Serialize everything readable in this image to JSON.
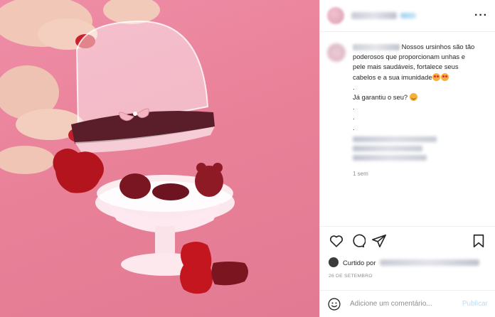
{
  "post": {
    "image_alt": "",
    "caption": {
      "line1": "Nossos ursinhos são tão",
      "line2": "poderosos que proporcionam unhas e",
      "line3": "pele mais saudáveis, fortalece seus",
      "line4": "cabelos e a sua imunidade",
      "dot1": ".",
      "question": "Já garantiu o seu?",
      "dot2": ".",
      "dot3": ".",
      "dot4": "."
    },
    "time_ago": "1 sem",
    "liked_by_prefix": "Curtido por",
    "date": "26 DE SETEMBRO",
    "comment_placeholder": "Adicione um comentário...",
    "publish_label": "Publicar",
    "more_label": "···"
  },
  "icons": {
    "like": "heart-icon",
    "comment": "comment-icon",
    "share": "share-icon",
    "save": "bookmark-icon",
    "emoji": "emoji-icon"
  },
  "colors": {
    "photo_bg": "#e98199",
    "publish_disabled": "#b2dffc"
  }
}
